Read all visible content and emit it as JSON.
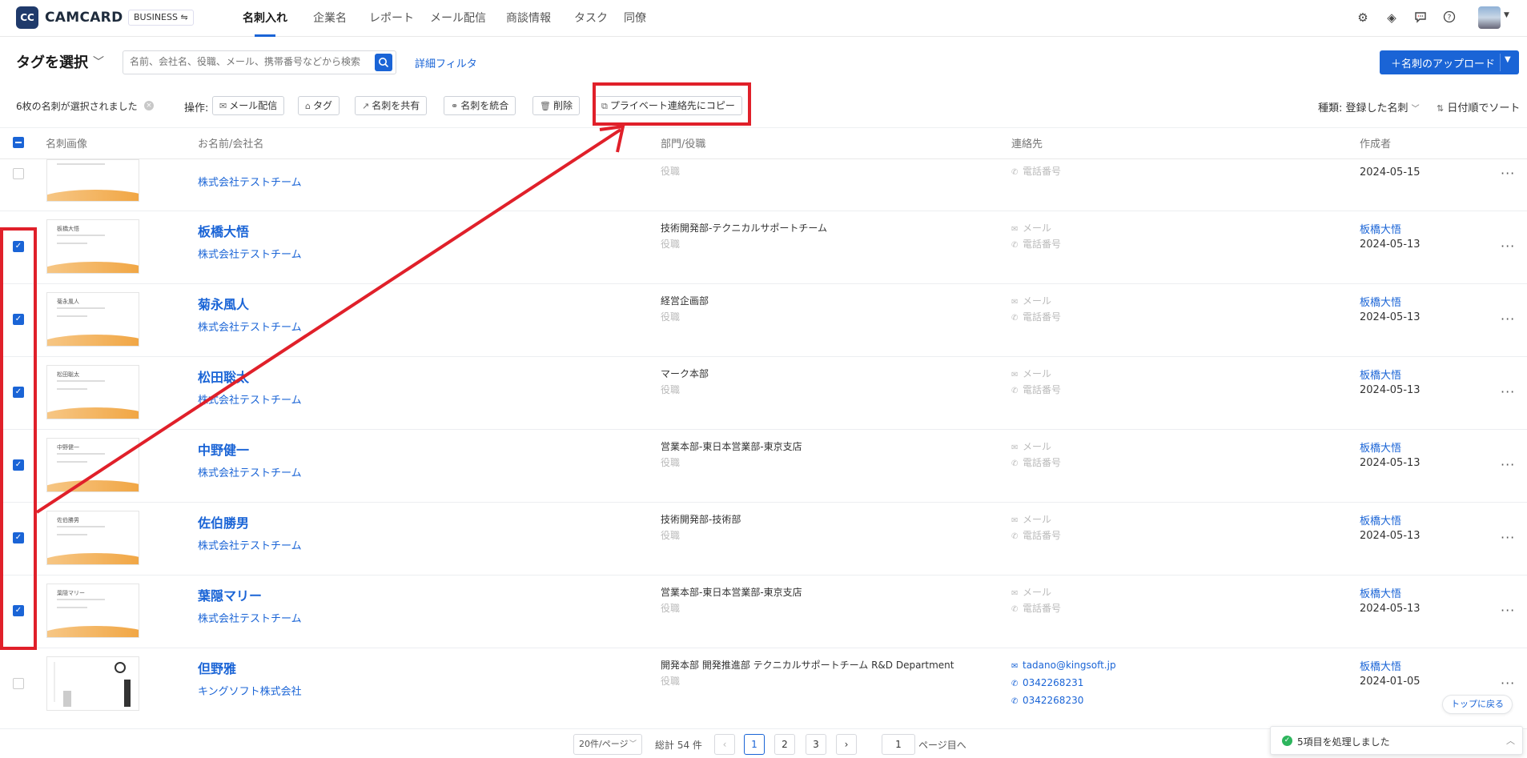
{
  "app": {
    "logo_text": "CC",
    "brand": "CAMCARD",
    "edition": "BUSINESS ⇋"
  },
  "nav": {
    "items": [
      {
        "label": "名刺入れ",
        "active": true
      },
      {
        "label": "企業名"
      },
      {
        "label": "レポート"
      },
      {
        "label": "メール配信"
      },
      {
        "label": "商談情報"
      },
      {
        "label": "タスク"
      },
      {
        "label": "同僚"
      }
    ]
  },
  "topicons": [
    "gear-icon",
    "layers-icon",
    "chat-icon",
    "help-icon"
  ],
  "filterbar": {
    "tag_select": "タグを選択",
    "search_placeholder": "名前、会社名、役職、メール、携帯番号などから検索",
    "advanced_filter": "詳細フィルタ",
    "upload_button": "＋名刺のアップロード"
  },
  "selection": {
    "info": "6枚の名刺が選択されました",
    "op_label": "操作:",
    "ops": [
      "メール配信",
      "タグ",
      "名刺を共有",
      "名刺を統合",
      "削除",
      "プライベート連絡先にコピー"
    ],
    "sort_type": "種類: 登録した名刺",
    "sort_date": "日付順でソート"
  },
  "table": {
    "headers": [
      "名刺画像",
      "お名前/会社名",
      "部門/役職",
      "連絡先",
      "作成者"
    ],
    "rows": [
      {
        "checked": false,
        "card_name": "",
        "name": "",
        "company": "株式会社テストチーム",
        "dept": "",
        "title_ph": "役職",
        "email": "",
        "phones": [
          "電話番号"
        ],
        "creator": "",
        "date": "2024-05-15"
      },
      {
        "checked": true,
        "card_name": "板橋大悟",
        "name": "板橋大悟",
        "company": "株式会社テストチーム",
        "dept": "技術開発部-テクニカルサポートチーム",
        "title_ph": "役職",
        "email": "メール",
        "phones": [
          "電話番号"
        ],
        "creator": "板橋大悟",
        "date": "2024-05-13"
      },
      {
        "checked": true,
        "card_name": "菊永風人",
        "name": "菊永風人",
        "company": "株式会社テストチーム",
        "dept": "経営企画部",
        "title_ph": "役職",
        "email": "メール",
        "phones": [
          "電話番号"
        ],
        "creator": "板橋大悟",
        "date": "2024-05-13"
      },
      {
        "checked": true,
        "card_name": "松田聡太",
        "name": "松田聡太",
        "company": "株式会社テストチーム",
        "dept": "マーク本部",
        "title_ph": "役職",
        "email": "メール",
        "phones": [
          "電話番号"
        ],
        "creator": "板橋大悟",
        "date": "2024-05-13"
      },
      {
        "checked": true,
        "card_name": "中野健一",
        "name": "中野健一",
        "company": "株式会社テストチーム",
        "dept": "営業本部-東日本営業部-東京支店",
        "title_ph": "役職",
        "email": "メール",
        "phones": [
          "電話番号"
        ],
        "creator": "板橋大悟",
        "date": "2024-05-13"
      },
      {
        "checked": true,
        "card_name": "佐伯勝男",
        "name": "佐伯勝男",
        "company": "株式会社テストチーム",
        "dept": "技術開発部-技術部",
        "title_ph": "役職",
        "email": "メール",
        "phones": [
          "電話番号"
        ],
        "creator": "板橋大悟",
        "date": "2024-05-13"
      },
      {
        "checked": true,
        "card_name": "葉隠マリー",
        "name": "葉隠マリー",
        "company": "株式会社テストチーム",
        "dept": "営業本部-東日本営業部-東京支店",
        "title_ph": "役職",
        "email": "メール",
        "phones": [
          "電話番号"
        ],
        "creator": "板橋大悟",
        "date": "2024-05-13"
      },
      {
        "checked": false,
        "card_name": "",
        "name": "但野雅",
        "company": "キングソフト株式会社",
        "dept": "開発本部 開発推進部 テクニカルサポートチーム R&D Department",
        "title_ph": "役職",
        "email": "tadano@kingsoft.jp",
        "phones": [
          "0342268231",
          "0342268230"
        ],
        "creator": "板橋大悟",
        "date": "2024-01-05"
      }
    ]
  },
  "pager": {
    "page_size": "20件/ページ",
    "total": "総計 54 件",
    "pages": [
      "1",
      "2",
      "3"
    ],
    "current": "1",
    "jump_value": "1",
    "jump_label": "ページ目へ"
  },
  "toast": {
    "message": "5項目を処理しました"
  },
  "back_to_top": "トップに戻る",
  "colors": {
    "accent": "#1a64d6",
    "annotation": "#e0202a"
  }
}
